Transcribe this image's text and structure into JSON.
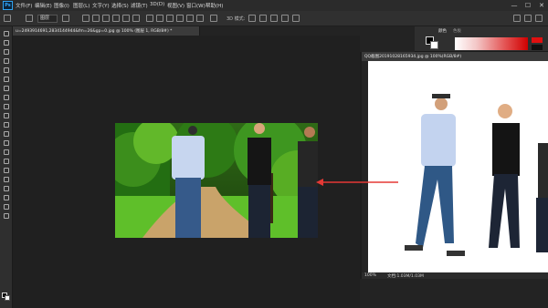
{
  "menubar": {
    "items": [
      "文件(F)",
      "编辑(E)",
      "图像(I)",
      "图层(L)",
      "文字(Y)",
      "选择(S)",
      "滤镜(T)",
      "3D(D)",
      "视图(V)",
      "窗口(W)",
      "帮助(H)"
    ],
    "window_controls": [
      "—",
      "☐",
      "✕"
    ]
  },
  "optionsbar": {
    "mode_label": "图层",
    "mode3d_label": "3D 模式:"
  },
  "document1": {
    "tab_label": "u=2493914691,2834144944&fm=26&gp=0.jpg @ 100% (图层 1, RGB/8#) *",
    "tab_close": "×"
  },
  "document2": {
    "tab_label": "QQ截图20191028165934.jpg @ 100%(RGB/8#)",
    "zoom": "100%",
    "doc_info": "文档:1.03M/1.03M"
  },
  "panel": {
    "tab_color": "颜色",
    "tab_swatches": "色板"
  },
  "colors": {
    "accent": "#31a8ff",
    "arrow": "#e53935",
    "fg": "#000000",
    "bg": "#ffffff"
  }
}
